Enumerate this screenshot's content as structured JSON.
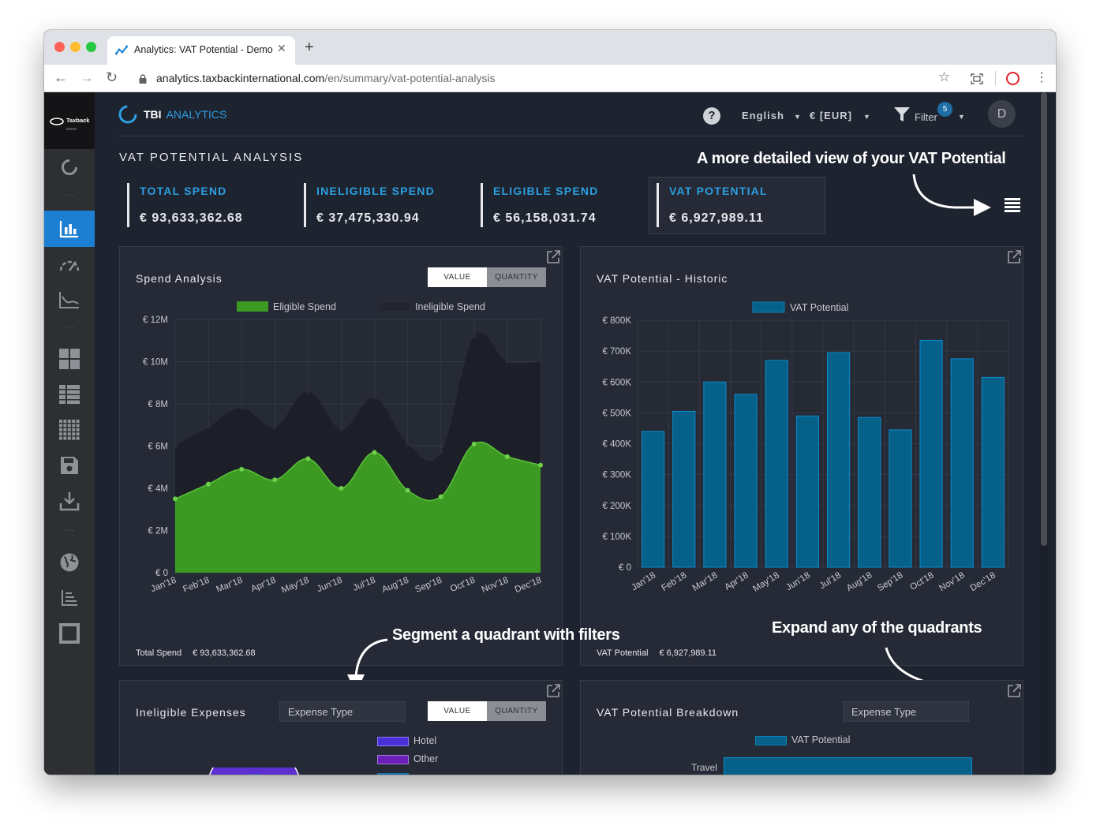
{
  "browser": {
    "tab_title": "Analytics: VAT Potential - Demo",
    "url_host": "analytics.taxbackinternational.com",
    "url_path": "/en/summary/vat-potential-analysis"
  },
  "sidebar": {
    "logo_text": "Taxback",
    "logo_sub": "DEMO"
  },
  "header": {
    "brand_tbi": "TBI",
    "brand_analytics": "ANALYTICS",
    "language": "English",
    "currency": "€ [EUR]",
    "filter_label": "Filter",
    "filter_count": "5",
    "user_initial": "D"
  },
  "page": {
    "title": "VAT POTENTIAL ANALYSIS",
    "kpis": [
      {
        "label": "TOTAL SPEND",
        "value": "€ 93,633,362.68"
      },
      {
        "label": "INELIGIBLE SPEND",
        "value": "€ 37,475,330.94"
      },
      {
        "label": "ELIGIBLE SPEND",
        "value": "€ 56,158,031.74"
      },
      {
        "label": "VAT POTENTIAL",
        "value": "€ 6,927,989.11"
      }
    ]
  },
  "annotations": {
    "detailed_view": "A more detailed view of your VAT Potential",
    "segment": "Segment a quadrant with filters",
    "expand": "Expand any of the quadrants"
  },
  "panels": {
    "spend_analysis": {
      "title": "Spend Analysis",
      "toggle_value": "VALUE",
      "toggle_quantity": "QUANTITY",
      "footer_label": "Total Spend",
      "footer_value": "€ 93,633,362.68"
    },
    "vat_historic": {
      "title": "VAT Potential - Historic",
      "footer_label": "VAT Potential",
      "footer_value": "€ 6,927,989.11"
    },
    "ineligible_expenses": {
      "title": "Ineligible Expenses",
      "select": "Expense Type",
      "toggle_value": "VALUE",
      "toggle_quantity": "QUANTITY",
      "legend": [
        {
          "label": "Hotel",
          "color": "#4a2fd6"
        },
        {
          "label": "Other",
          "color": "#6a1fb8"
        }
      ]
    },
    "vat_breakdown": {
      "title": "VAT Potential Breakdown",
      "select": "Expense Type",
      "legend_label": "VAT Potential",
      "first_bar_label": "Travel"
    }
  },
  "chart_data": [
    {
      "type": "area",
      "title": "Spend Analysis",
      "categories": [
        "Jan'18",
        "Feb'18",
        "Mar'18",
        "Apr'18",
        "May'18",
        "Jun'18",
        "Jul'18",
        "Aug'18",
        "Sep'18",
        "Oct'18",
        "Nov'18",
        "Dec'18"
      ],
      "series": [
        {
          "name": "Eligible Spend",
          "color": "#3c9a22",
          "values": [
            3.5,
            4.2,
            4.9,
            4.4,
            5.4,
            4.0,
            5.7,
            3.9,
            3.6,
            6.1,
            5.5,
            5.1
          ]
        },
        {
          "name": "Ineligible Spend",
          "color": "#22252f",
          "values": [
            6.0,
            6.9,
            7.8,
            6.9,
            8.6,
            6.8,
            8.3,
            6.1,
            5.7,
            11.2,
            10.0,
            10.0
          ]
        }
      ],
      "y_ticks": [
        "€ 0",
        "€ 2M",
        "€ 4M",
        "€ 6M",
        "€ 8M",
        "€ 10M",
        "€ 12M"
      ],
      "ylim": [
        0,
        12
      ],
      "units": "M EUR",
      "grid": true,
      "legend": "top"
    },
    {
      "type": "bar",
      "title": "VAT Potential - Historic",
      "categories": [
        "Jan'18",
        "Feb'18",
        "Mar'18",
        "Apr'18",
        "May'18",
        "Jun'18",
        "Jul'18",
        "Aug'18",
        "Sep'18",
        "Oct'18",
        "Nov'18",
        "Dec'18"
      ],
      "series": [
        {
          "name": "VAT Potential",
          "color": "#05608a",
          "values": [
            440000,
            505000,
            600000,
            560000,
            670000,
            490000,
            695000,
            485000,
            445000,
            735000,
            675000,
            615000
          ]
        }
      ],
      "y_ticks": [
        "€ 0",
        "€ 100K",
        "€ 200K",
        "€ 300K",
        "€ 400K",
        "€ 500K",
        "€ 600K",
        "€ 700K",
        "€ 800K"
      ],
      "ylim": [
        0,
        800000
      ],
      "grid": true,
      "legend": "top"
    }
  ]
}
